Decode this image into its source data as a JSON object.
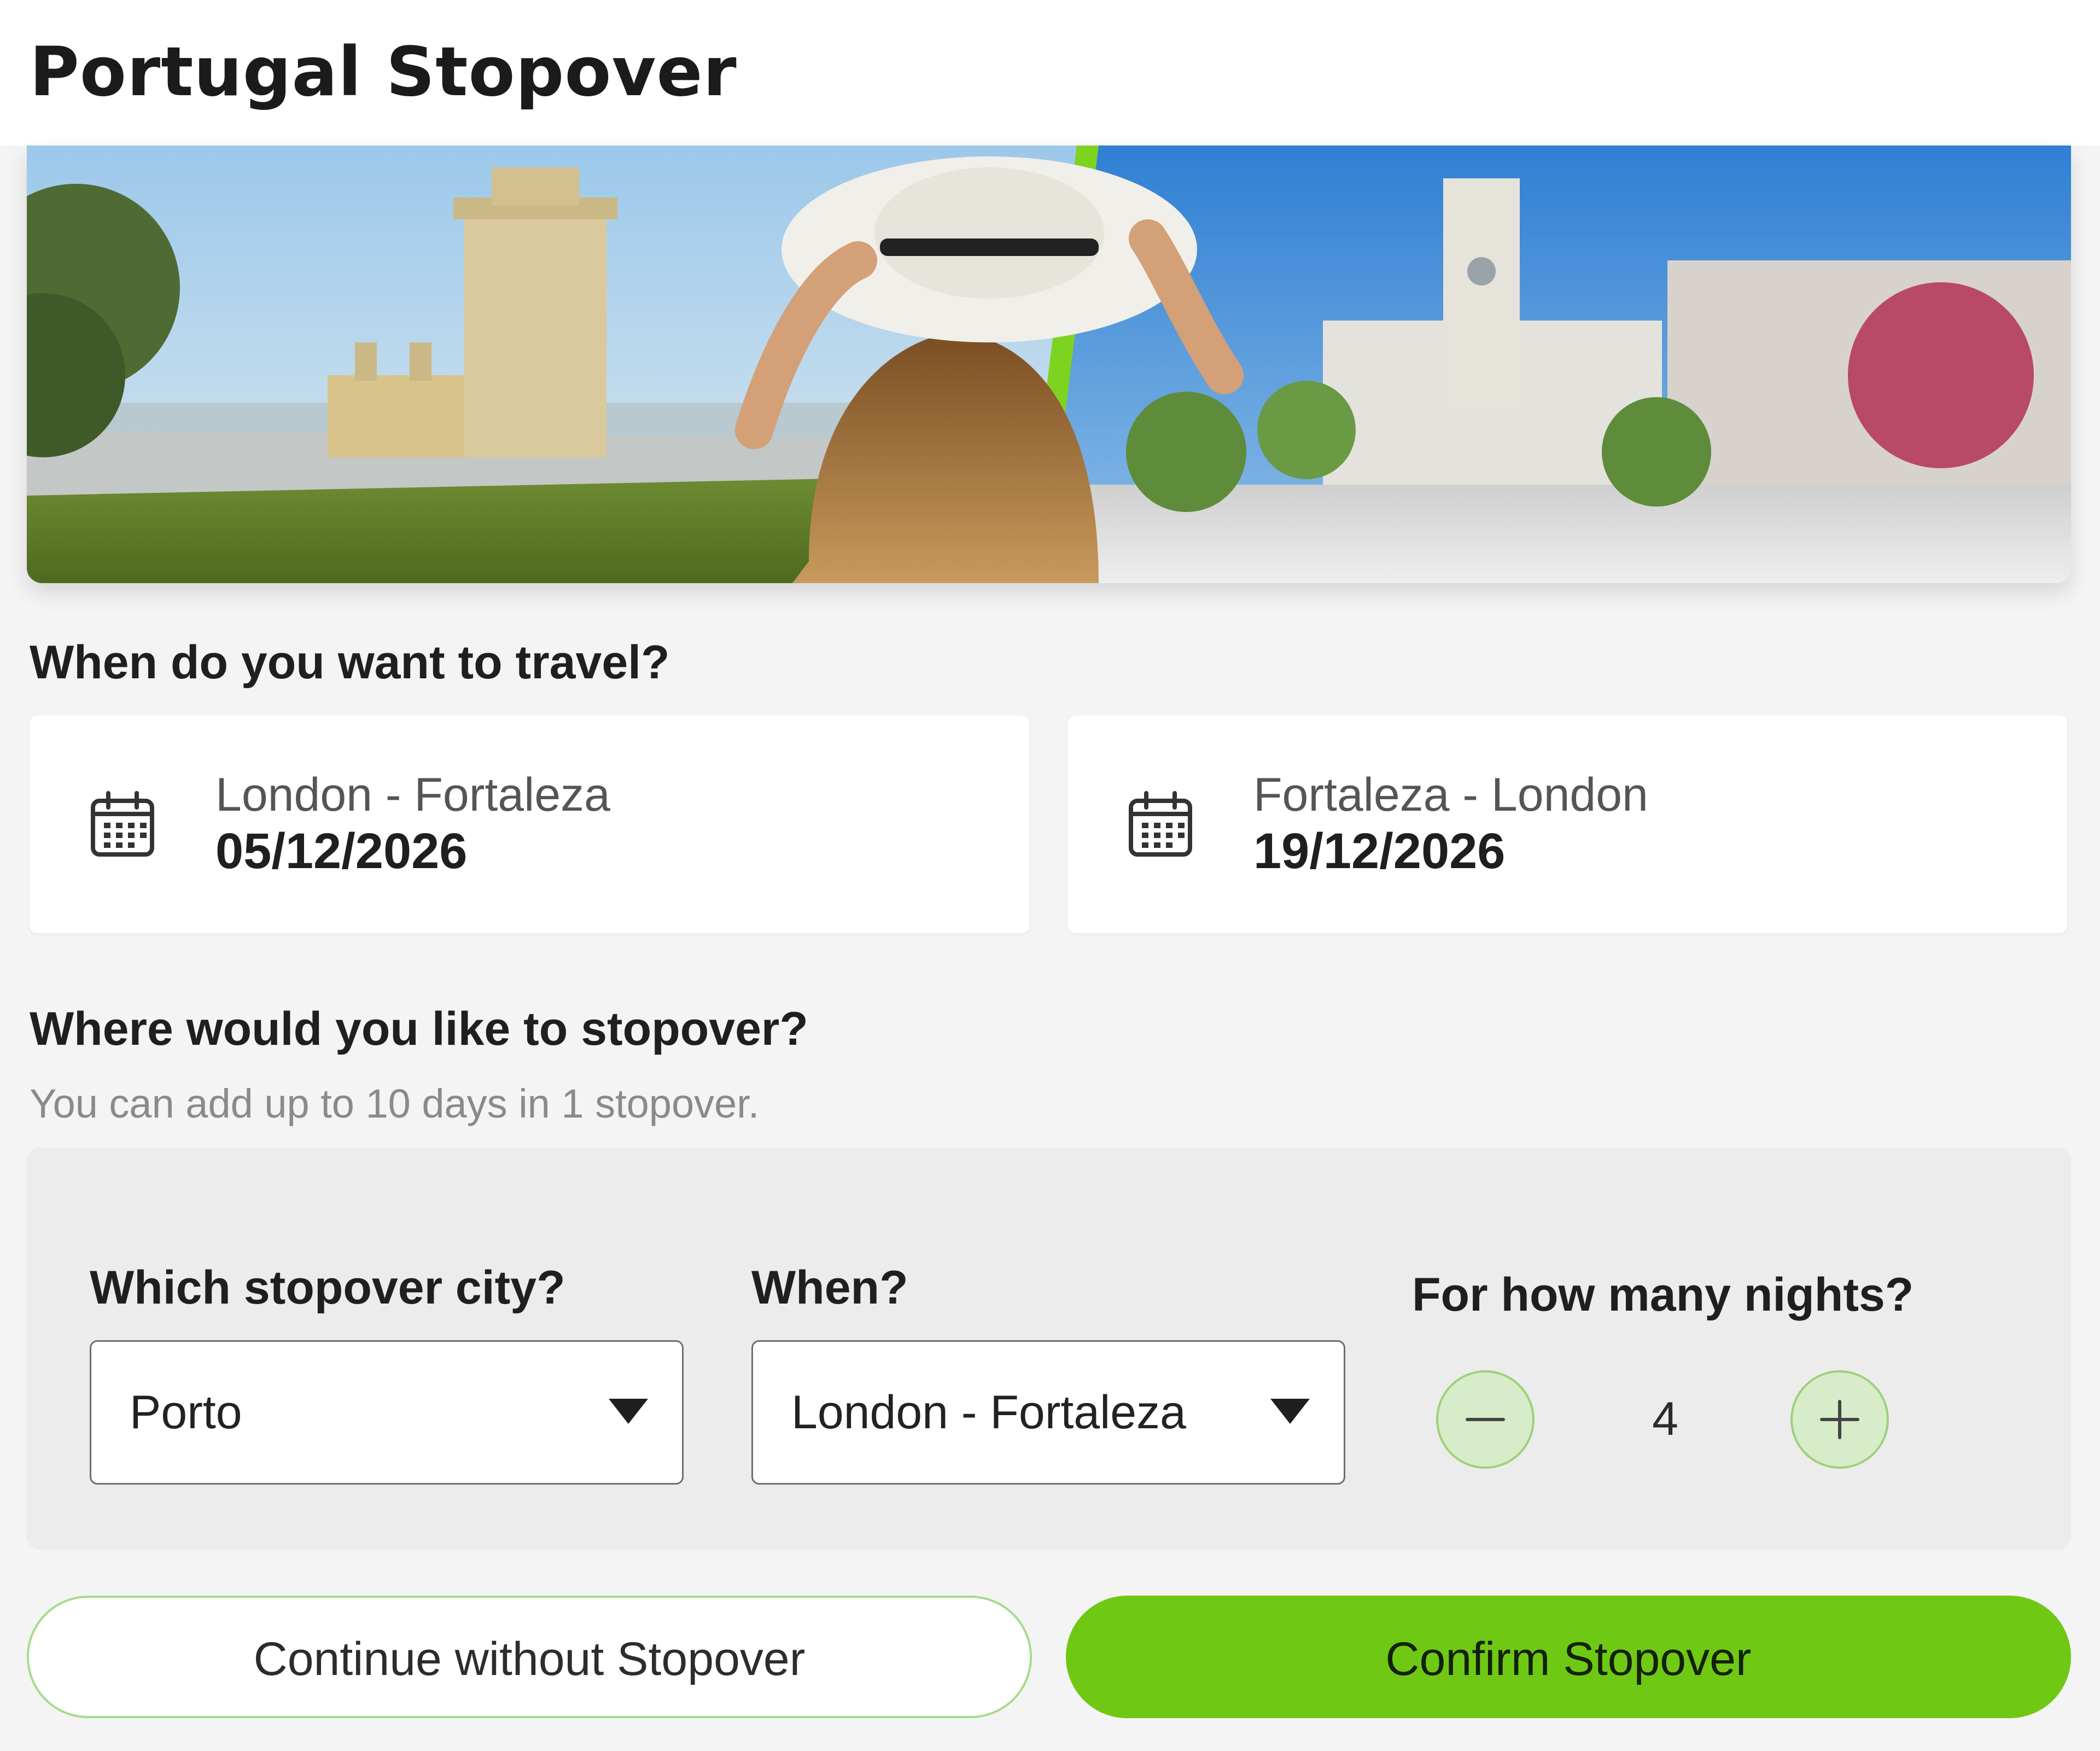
{
  "header": {
    "title": "Portugal Stopover"
  },
  "hero": {
    "image": "Lisbon Belém Tower and Porto City Hall with traveller in sun hat"
  },
  "travel": {
    "heading": "When do you want to travel?",
    "outbound": {
      "route": "London - Fortaleza",
      "date": "05/12/2026",
      "icon": "calendar-icon"
    },
    "inbound": {
      "route": "Fortaleza - London",
      "date": "19/12/2026",
      "icon": "calendar-icon"
    }
  },
  "stopover": {
    "heading": "Where would you like to stopover?",
    "hint": "You can add up to 10 days in 1 stopover.",
    "city": {
      "label": "Which stopover city?",
      "value": "Porto"
    },
    "when": {
      "label": "When?",
      "value": "London - Fortaleza"
    },
    "nights": {
      "label": "For how many nights?",
      "value": "4",
      "minus": "minus-icon",
      "plus": "plus-icon"
    }
  },
  "actions": {
    "continue_label": "Continue without Stopover",
    "confirm_label": "Confirm Stopover"
  },
  "colors": {
    "accent": "#6fc914",
    "accent_light": "#d7ecc9",
    "background": "#f4f4f4",
    "panel": "#ececec"
  }
}
